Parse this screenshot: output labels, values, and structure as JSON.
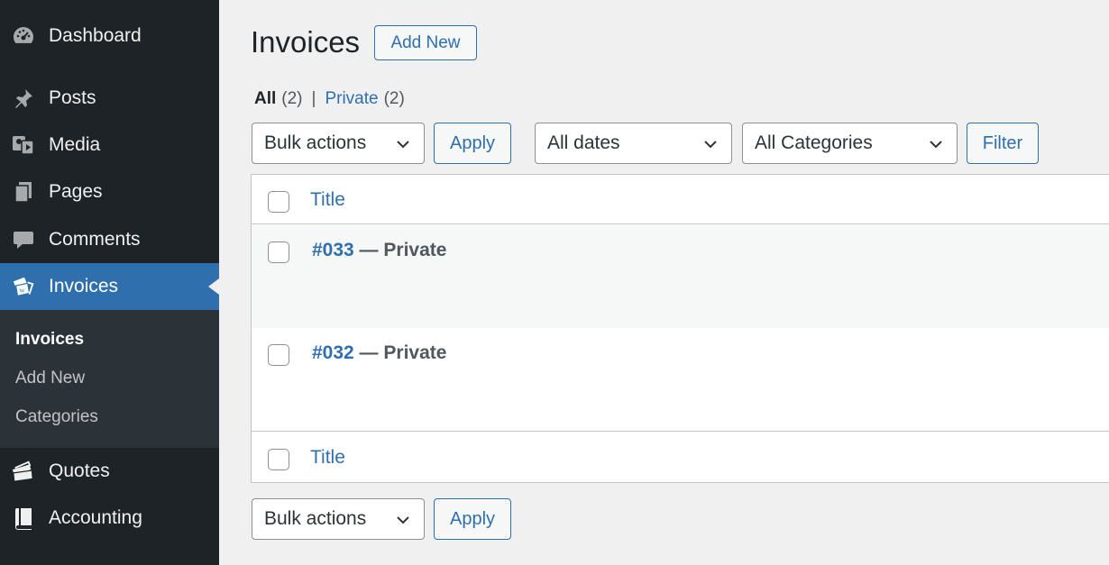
{
  "sidebar": {
    "items": [
      {
        "label": "Dashboard",
        "icon": "dashboard-icon"
      },
      {
        "label": "Posts",
        "icon": "pin-icon"
      },
      {
        "label": "Media",
        "icon": "media-icon"
      },
      {
        "label": "Pages",
        "icon": "pages-icon"
      },
      {
        "label": "Comments",
        "icon": "comment-icon"
      },
      {
        "label": "Invoices",
        "icon": "invoice-icon",
        "active": true
      },
      {
        "label": "Quotes",
        "icon": "quotes-icon"
      },
      {
        "label": "Accounting",
        "icon": "book-icon"
      }
    ],
    "submenu": [
      {
        "label": "Invoices",
        "current": true
      },
      {
        "label": "Add New"
      },
      {
        "label": "Categories"
      }
    ]
  },
  "page": {
    "title": "Invoices",
    "add_new_label": "Add New"
  },
  "views": {
    "all_label": "All",
    "all_count": "(2)",
    "separator": "|",
    "private_label": "Private",
    "private_count": "(2)"
  },
  "filters": {
    "bulk_actions": "Bulk actions",
    "apply_label": "Apply",
    "dates": "All dates",
    "categories": "All Categories",
    "filter_label": "Filter"
  },
  "table": {
    "column_title": "Title",
    "rows": [
      {
        "number": "#033",
        "state": " — Private"
      },
      {
        "number": "#032",
        "state": " — Private"
      }
    ]
  },
  "colors": {
    "sidebar_bg": "#1d2327",
    "accent": "#2f6fad",
    "page_bg": "#f0f0f1"
  }
}
